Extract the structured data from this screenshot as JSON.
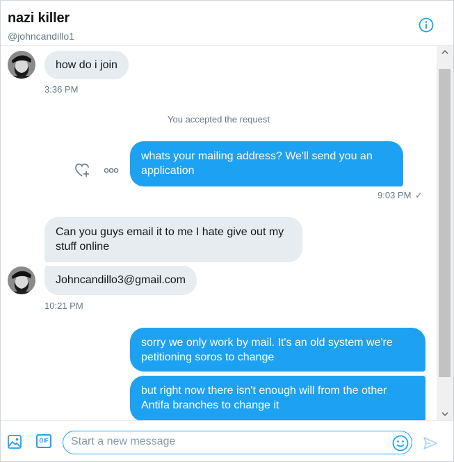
{
  "header": {
    "name": "nazi killer",
    "handle": "@johncandillo1"
  },
  "messages": [
    {
      "dir": "in",
      "text": "how do i join"
    },
    {
      "type": "meta",
      "text": "3:36 PM"
    },
    {
      "type": "system",
      "text": "You accepted the request"
    },
    {
      "dir": "out",
      "line1": "whats your mailing address? We'll send you an",
      "line2": "application"
    },
    {
      "type": "meta",
      "text": "9:03 PM",
      "status": "✓"
    },
    {
      "dir": "in",
      "line1": "Can you guys email it to me I hate give out my",
      "line2": "stuff online"
    },
    {
      "dir": "in",
      "text": "Johncandillo3@gmail.com"
    },
    {
      "type": "meta",
      "text": "10:21 PM"
    },
    {
      "dir": "out",
      "line1": "sorry we only work by mail. It's an old system we're",
      "line2": "petitioning soros to change"
    },
    {
      "dir": "out",
      "line1": "but right now there isn't enough will from the other",
      "line2": "Antifa branches to change it"
    }
  ],
  "composer": {
    "placeholder": "Start a new message",
    "gif_label": "GIF"
  },
  "colors": {
    "accent": "#1da1f2",
    "incoming": "#e6ecf0",
    "muted": "#657786"
  }
}
